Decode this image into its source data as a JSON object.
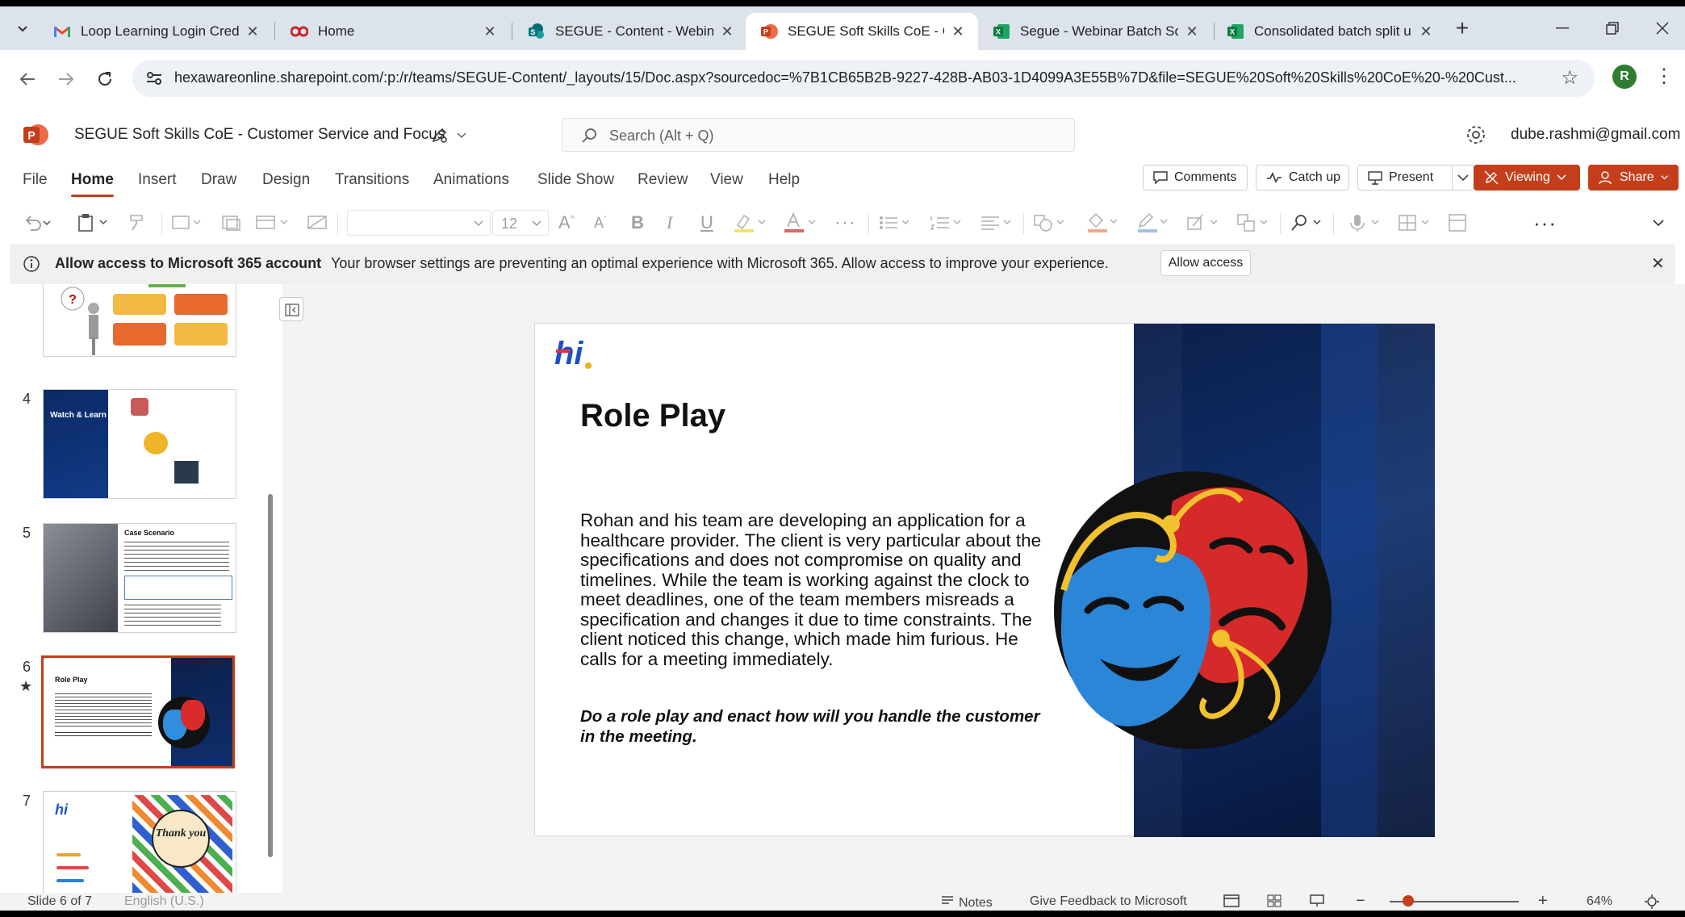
{
  "browser": {
    "tabs": [
      {
        "title": "Loop Learning Login Crede",
        "icon": "gmail-icon",
        "active": false
      },
      {
        "title": "Home",
        "icon": "loop-icon",
        "active": false
      },
      {
        "title": "SEGUE - Content - Webina",
        "icon": "sharepoint-icon",
        "active": false
      },
      {
        "title": "SEGUE Soft Skills CoE - Cu",
        "icon": "powerpoint-icon",
        "active": true
      },
      {
        "title": "Segue - Webinar Batch Sc",
        "icon": "excel-icon",
        "active": false
      },
      {
        "title": "Consolidated batch split u",
        "icon": "excel-icon",
        "active": false
      }
    ],
    "close_glyph": "✕",
    "new_tab_glyph": "+",
    "url": "hexawareonline.sharepoint.com/:p:/r/teams/SEGUE-Content/_layouts/15/Doc.aspx?sourcedoc=%7B1CB65B2B-9227-428B-AB03-1D4099A3E55B%7D&file=SEGUE%20Soft%20Skills%20CoE%20-%20Cust...",
    "profile_initial": "R"
  },
  "app": {
    "doc_title": "SEGUE Soft Skills CoE - Customer Service and Focus",
    "search_placeholder": "Search (Alt + Q)",
    "account": "dube.rashmi@gmail.com",
    "menus": [
      "File",
      "Home",
      "Insert",
      "Draw",
      "Design",
      "Transitions",
      "Animations",
      "Slide Show",
      "Review",
      "View",
      "Help"
    ],
    "active_menu": "Home",
    "buttons": {
      "comments": "Comments",
      "catch_up": "Catch up",
      "present": "Present",
      "viewing": "Viewing",
      "share": "Share"
    },
    "font_size": "12"
  },
  "infobar": {
    "title": "Allow access to Microsoft 365 account",
    "message": "Your browser settings are preventing an optimal experience with Microsoft 365. Allow access to improve your experience.",
    "button": "Allow access"
  },
  "thumbnails": {
    "numbers": [
      "4",
      "5",
      "6",
      "7"
    ],
    "slide4_label": "Watch & Learn",
    "slide5_label": "Case Scenario",
    "slide6_label": "Role Play",
    "slide7_label": "Thank you"
  },
  "slide": {
    "logo": "hi",
    "title": "Role Play",
    "body": "Rohan and his team are developing an application for a healthcare provider. The client is very particular about the specifications and does not compromise on quality and timelines. While the team is working against the clock to meet deadlines, one of the team members misreads a specification and changes it due to time constraints. The client noticed this change, which made him furious. He calls for a meeting immediately.",
    "task": "Do a role play and enact how will you handle the customer in the meeting."
  },
  "status": {
    "slide_counter": "Slide 6 of 7",
    "language": "English (U.S.)",
    "notes": "Notes",
    "feedback": "Give Feedback to Microsoft",
    "zoom": "64%"
  },
  "colors": {
    "accent": "#c43e1c",
    "slide_panel": "#0b1f4a"
  }
}
